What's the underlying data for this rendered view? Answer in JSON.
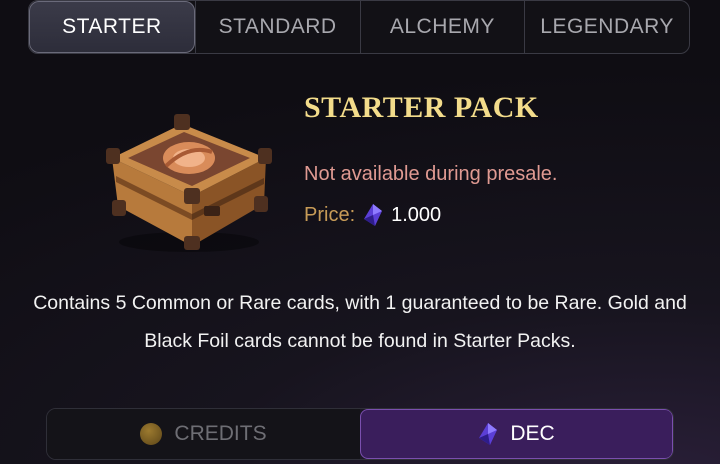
{
  "tabs": [
    {
      "label": "STARTER",
      "active": true
    },
    {
      "label": "STANDARD",
      "active": false
    },
    {
      "label": "ALCHEMY",
      "active": false
    },
    {
      "label": "LEGENDARY",
      "active": false
    }
  ],
  "pack": {
    "title": "STARTER PACK",
    "availability": "Not available during presale.",
    "price_label": "Price:",
    "price_value": "1.000",
    "price_icon": "dec-gem-icon",
    "description": "Contains 5 Common or Rare cards, with 1 guaranteed to be Rare. Gold and Black Foil cards cannot be found in Starter Packs."
  },
  "currency": {
    "credits_label": "CREDITS",
    "dec_label": "DEC",
    "selected": "DEC"
  },
  "colors": {
    "title": "#f3dc8b",
    "warning": "#e09a92",
    "price_label": "#c79b57",
    "dec_accent": "#3a1e5c"
  }
}
